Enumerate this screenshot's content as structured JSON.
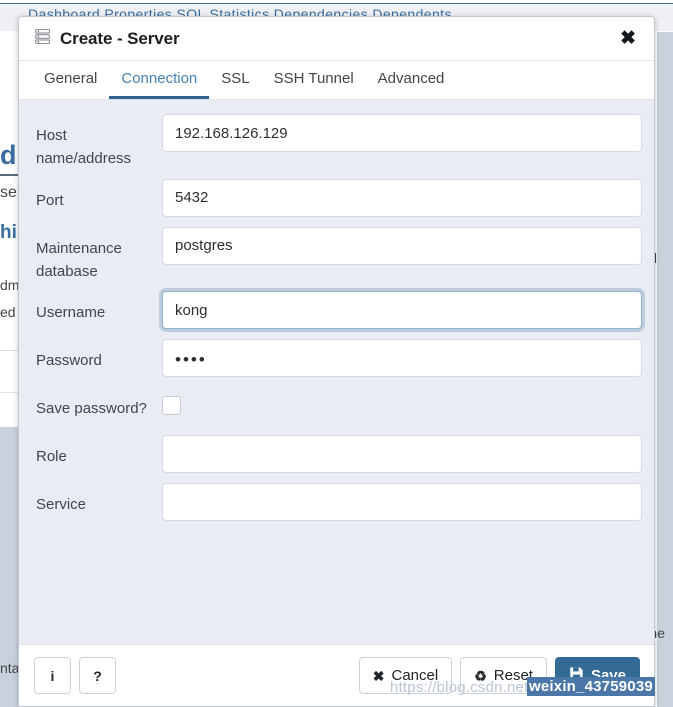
{
  "background": {
    "tabstrip_text": "Dashboard   Properties   SQL   Statistics   Dependencies   Dependents",
    "left_title": "dr",
    "left_line1": "ser",
    "left_line2": "his",
    "left_line3": "dm",
    "left_line4": "ed",
    "left_bottom": "nta",
    "right_text1": "nical",
    "right_text2": "Plane"
  },
  "dialog": {
    "title": "Create - Server",
    "title_icon": "server-icon",
    "close_icon": "✖",
    "tabs": [
      {
        "label": "General",
        "active": false
      },
      {
        "label": "Connection",
        "active": true
      },
      {
        "label": "SSL",
        "active": false
      },
      {
        "label": "SSH Tunnel",
        "active": false
      },
      {
        "label": "Advanced",
        "active": false
      }
    ],
    "fields": {
      "host": {
        "label": "Host name/address",
        "value": "192.168.126.129",
        "placeholder": ""
      },
      "port": {
        "label": "Port",
        "value": "5432",
        "placeholder": ""
      },
      "maintenance_db": {
        "label": "Maintenance database",
        "value": "postgres",
        "placeholder": ""
      },
      "username": {
        "label": "Username",
        "value": "kong",
        "placeholder": "",
        "focused": true
      },
      "password": {
        "label": "Password",
        "value": "••••",
        "placeholder": ""
      },
      "save_password": {
        "label": "Save password?",
        "checked": false
      },
      "role": {
        "label": "Role",
        "value": "",
        "placeholder": ""
      },
      "service": {
        "label": "Service",
        "value": "",
        "placeholder": ""
      }
    },
    "footer": {
      "info_label": "i",
      "help_label": "?",
      "cancel_label": "Cancel",
      "cancel_icon": "✖",
      "reset_label": "Reset",
      "reset_icon": "♻",
      "save_label": "Save",
      "save_icon": "💾"
    }
  },
  "watermark": {
    "url_prefix": "https://blog.csdn.net/",
    "url_user": "weixin_43759039"
  },
  "colors": {
    "accent": "#4682b4",
    "tab_underline": "#31638f",
    "primary_button": "#336b96",
    "body_background": "#e9ecf2",
    "panel_background": "#ffffff"
  }
}
